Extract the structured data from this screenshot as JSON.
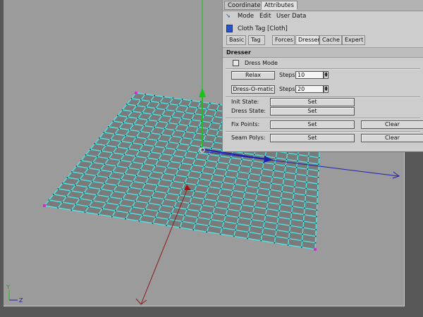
{
  "tabs_top": [
    "Coordinates",
    "Attributes"
  ],
  "menu": [
    "Mode",
    "Edit",
    "User Data"
  ],
  "tag_title": "Cloth Tag [Cloth]",
  "subtabs": [
    "Basic",
    "Tag",
    "Forces",
    "Dresser",
    "Cache",
    "Expert"
  ],
  "section": "Dresser",
  "dress_mode_label": "Dress Mode",
  "relax_button": "Relax",
  "relax_steps_label": "Steps",
  "relax_steps_value": "10",
  "dressomatic_button": "Dress-O-matic",
  "dressomatic_steps_label": "Steps",
  "dressomatic_steps_value": "20",
  "init_state_label": "Init State:",
  "dress_state_label": "Dress State:",
  "fix_points_label": "Fix Points:",
  "seam_polys_label": "Seam Polys:",
  "set_label": "Set",
  "clear_label": "Clear",
  "axis_labels": {
    "y": "Y",
    "z": "Z"
  },
  "colors": {
    "viewport_bg": "#9b9b9b",
    "mesh_face": "#7a7a7a",
    "mesh_edge": "#4fe3e3",
    "y_axis": "#19c419",
    "x_axis": "#1f1fb0",
    "z_axis": "#8a1a1a"
  }
}
